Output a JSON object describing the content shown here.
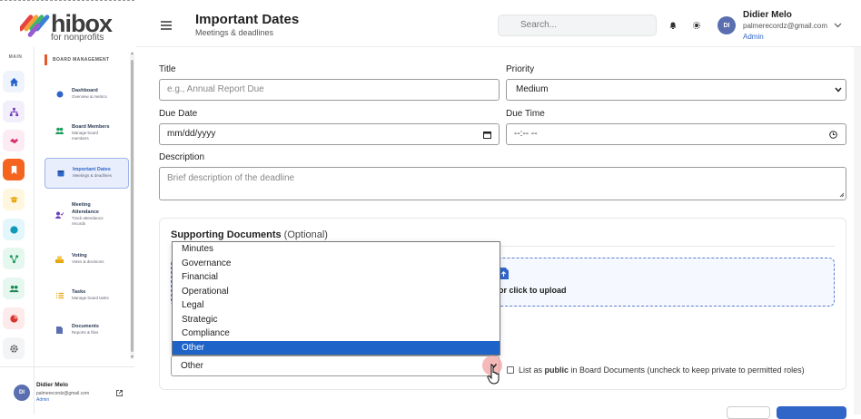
{
  "brand": {
    "name": "hibox",
    "tagline": "for nonprofits"
  },
  "rail": {
    "label": "MAIN",
    "icons": [
      "home-icon",
      "sitemap-icon",
      "handshake-icon",
      "bookmark-icon",
      "graduation-icon",
      "globe-icon",
      "network-icon",
      "users-icon",
      "chart-pie-icon",
      "gear-icon"
    ]
  },
  "sidebar": {
    "heading": "BOARD MANAGEMENT",
    "items": [
      {
        "title": "Dashboard",
        "subtitle": "Overview & metrics"
      },
      {
        "title": "Board Members",
        "subtitle": "Manage board members"
      },
      {
        "title": "Important Dates",
        "subtitle": "Meetings & deadlines"
      },
      {
        "title": "Meeting Attendance",
        "subtitle": "Track attendance records"
      },
      {
        "title": "Voting",
        "subtitle": "Votes & decisions"
      },
      {
        "title": "Tasks",
        "subtitle": "Manage board tasks"
      },
      {
        "title": "Documents",
        "subtitle": "Reports & files"
      }
    ],
    "user": {
      "initials": "DI",
      "name": "Didier Melo",
      "email": "palmerecordz@gmail.com",
      "role": "Admin"
    }
  },
  "header": {
    "title": "Important Dates",
    "subtitle": "Meetings & deadlines",
    "search_placeholder": "Search...",
    "user": {
      "initials": "DI",
      "name": "Didier Melo",
      "email": "palmerecordz@gmail.com",
      "role": "Admin"
    }
  },
  "form": {
    "title_label": "Title",
    "title_placeholder": "e.g., Annual Report Due",
    "priority_label": "Priority",
    "priority_value": "Medium",
    "due_date_label": "Due Date",
    "due_date_value": "mm/dd/yyyy",
    "due_time_label": "Due Time",
    "due_time_value": "--:-- --",
    "description_label": "Description",
    "description_placeholder": "Brief description of the deadline"
  },
  "docs": {
    "heading": "Supporting Documents",
    "heading_optional": "(Optional)",
    "upload_text": "or click to upload",
    "category_options": [
      "Minutes",
      "Governance",
      "Financial",
      "Operational",
      "Legal",
      "Strategic",
      "Compliance",
      "Other"
    ],
    "selected_option": "Other",
    "public_label_pre": "List as ",
    "public_label_bold": "public",
    "public_label_post": " in Board Documents (uncheck to keep private to permitted roles)"
  },
  "colors": {
    "accent": "#1e63c7",
    "active_bg": "#e8eefb",
    "brand_orange": "#e05a2b"
  }
}
